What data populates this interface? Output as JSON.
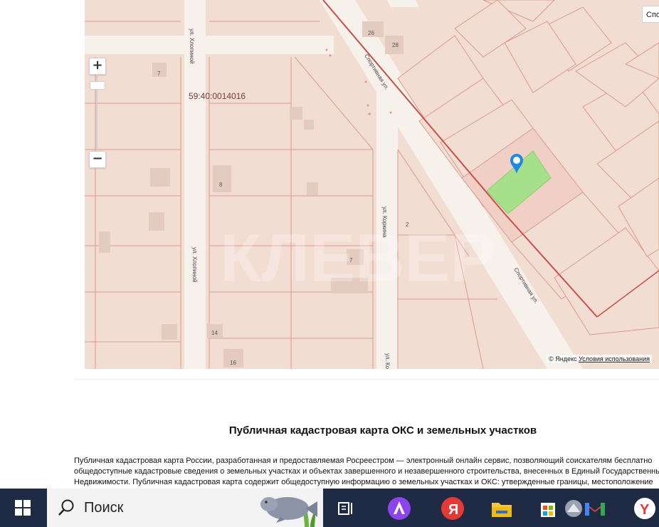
{
  "map": {
    "parcel_id": "59:40:0014016",
    "streets": {
      "khlopina_top": "ул. Хлопиной",
      "khlopina_mid": "ул. Хлопиной",
      "sportivnaya_top": "Спортивная ул.",
      "sportivnaya_bottom": "Спортивная ул.",
      "korkina_top": "ул. Коркина",
      "korkina_bottom": "ул. Ко"
    },
    "house_numbers": [
      "26",
      "28",
      "7",
      "8",
      "2",
      "7",
      "14",
      "16"
    ],
    "zoom_in_label": "+",
    "zoom_out_label": "−",
    "layer_button_label": "Спо",
    "watermark": "КЛЕВЕР",
    "copyright_text": "© Яндекс",
    "terms_link": "Условия использования",
    "colors": {
      "parcel_fill": "#f2ddd3",
      "parcel_border": "#d99a8c",
      "highlight_fill": "#a6e08a",
      "boundary": "#c8504a",
      "road": "#f7f1ec"
    }
  },
  "article": {
    "title": "Публичная кадастровая карта ОКС и земельных участков",
    "lines": [
      "Публичная кадастровая карта России, разработанная и предоставляемая Росреестром — электронный онлайн сервис, позволяющий соискателям бесплатно",
      "общедоступные кадастровые сведения о земельных участках и объектах завершенного и незавершенного строительства, внесенных в Единый Государственны",
      "Недвижимости. Публичная кадастровая карта содержит общедоступную информацию о земельных участках и ОКС: утвержденные границы, местоположение"
    ]
  },
  "taskbar": {
    "search_placeholder": "Поиск",
    "icons": [
      "windows-logo",
      "search-icon",
      "task-view-icon",
      "alice-icon",
      "yandex-browser-icon",
      "file-explorer-icon",
      "microsoft-store-icon",
      "gmail-icon",
      "yandex-icon"
    ],
    "bg_color": "#1f2a44"
  }
}
